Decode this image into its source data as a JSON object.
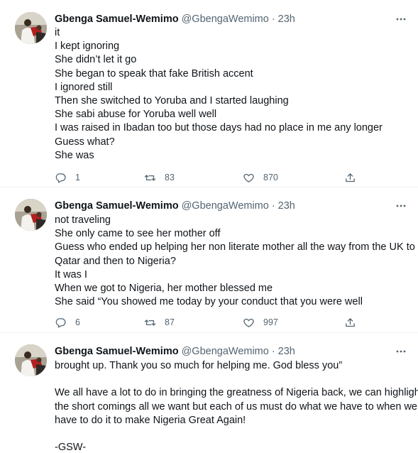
{
  "tweets": [
    {
      "author_name": "Gbenga Samuel-Wemimo",
      "handle": "@GbengaWemimo",
      "separator": "·",
      "time": "23h",
      "lines": [
        "it",
        "I kept ignoring",
        "She didn’t let it go",
        "She began to speak that fake British accent",
        "I ignored still",
        "Then she switched to Yoruba and I started laughing",
        "She sabi abuse for Yoruba well well",
        "I was raised in Ibadan too but those days had no place in me any longer",
        "Guess what?",
        "She was"
      ],
      "replies": "1",
      "retweets": "83",
      "likes": "870"
    },
    {
      "author_name": "Gbenga Samuel-Wemimo",
      "handle": "@GbengaWemimo",
      "separator": "·",
      "time": "23h",
      "lines": [
        "not traveling",
        "She only came to see her mother off",
        "Guess who ended up helping her non literate mother all the way from the UK to",
        "Qatar and then to Nigeria?",
        "It was I",
        "When we got to Nigeria, her mother blessed me",
        "She said “You showed me today by your conduct that you were well"
      ],
      "replies": "6",
      "retweets": "87",
      "likes": "997"
    },
    {
      "author_name": "Gbenga Samuel-Wemimo",
      "handle": "@GbengaWemimo",
      "separator": "·",
      "time": "23h",
      "lines": [
        "brought up. Thank you so much for helping me. God bless you”",
        "",
        "We all have a lot to do in bringing the greatness of Nigeria back, we can highlight",
        "the short comings all we want but each of us must do what we have to when we",
        "have to do it to make Nigeria Great Again!",
        "",
        "-GSW-"
      ]
    }
  ],
  "colors": {
    "text_primary": "#0f1419",
    "text_secondary": "#536471",
    "divider": "#eff3f4"
  },
  "icons": [
    "avatar",
    "more-icon",
    "reply-icon",
    "retweet-icon",
    "like-icon",
    "share-icon"
  ]
}
